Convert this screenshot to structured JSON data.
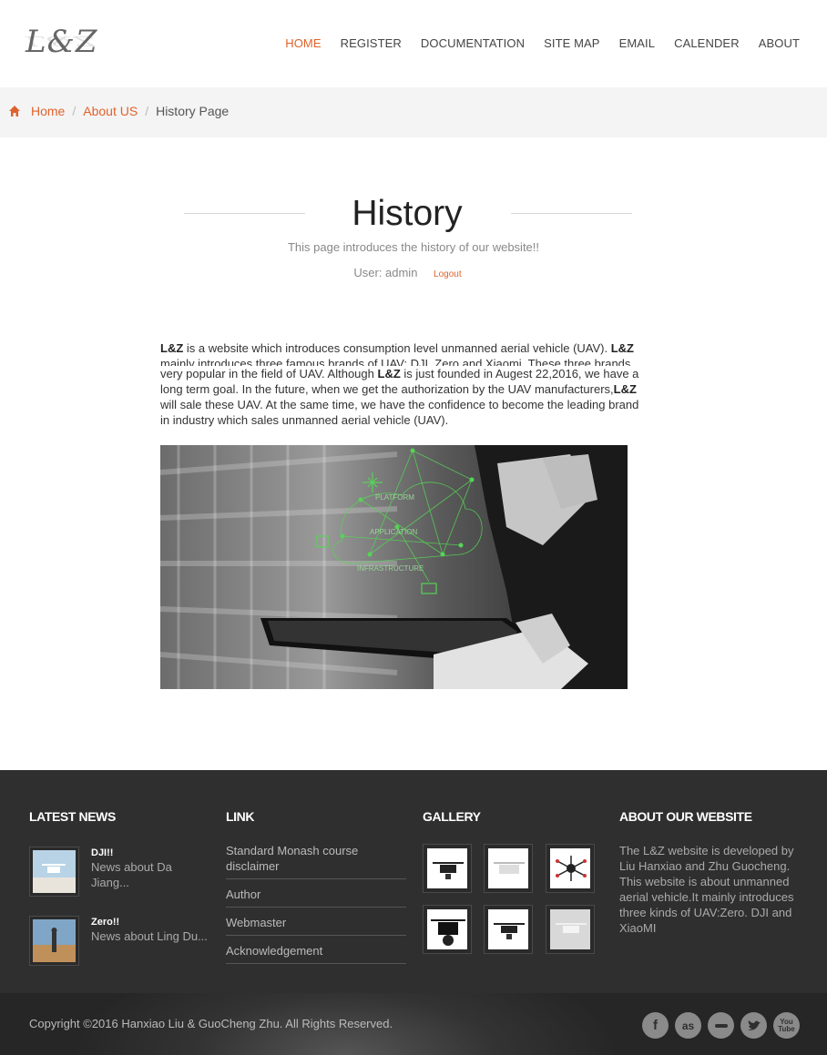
{
  "header": {
    "logo_text": "L&Z",
    "nav": [
      {
        "label": "HOME",
        "active": true
      },
      {
        "label": "REGISTER"
      },
      {
        "label": "DOCUMENTATION"
      },
      {
        "label": "SITE MAP"
      },
      {
        "label": "EMAIL"
      },
      {
        "label": "CALENDER"
      },
      {
        "label": "ABOUT"
      }
    ]
  },
  "breadcrumb": {
    "items": [
      "Home",
      "About US"
    ],
    "current": "History Page"
  },
  "page": {
    "title": "History",
    "subtitle": "This page introduces the history of our website!!",
    "user_label": "User: admin",
    "logout_label": "Logout"
  },
  "content": {
    "brand": "L&Z",
    "p1a": " is a website which introduces consumption level unmanned aerial vehicle (UAV). ",
    "p1b": "mainly introduces three famous brands of UAV: DJI, Zero and Xiaomi. These three brands are",
    "p1c": "very popular in the field of UAV. Although ",
    "p1d": " is just founded in Augest 22,2016, we have a long term goal. In the future, when we get the authorization by the UAV manufacturers,",
    "p1e": " will sale these UAV. At the same time, we have the confidence to become the leading brand in industry which sales unmanned aerial vehicle (UAV).",
    "hero_overlay_labels": [
      "PLATFORM",
      "APPLICATION",
      "INFRASTRUCTURE"
    ]
  },
  "footer": {
    "latest_news_heading": "LATEST NEWS",
    "news": [
      {
        "title": "DJI!!",
        "desc": "News about Da Jiang..."
      },
      {
        "title": "Zero!!",
        "desc": "News about Ling Du..."
      }
    ],
    "link_heading": "LINK",
    "links": [
      "Standard Monash course disclaimer",
      "Author",
      "Webmaster",
      "Acknowledgement"
    ],
    "gallery_heading": "GALLERY",
    "about_heading": "ABOUT OUR WEBSITE",
    "about_text": "The L&Z website is developed by Liu Hanxiao and Zhu Guocheng. This website is about unmanned aerial vehicle.It mainly introduces three kinds of UAV:Zero. DJI and XiaoMI",
    "copyright": "Copyright ©2016 Hanxiao Liu & GuoCheng Zhu. All Rights Reserved.",
    "social_icons": [
      "facebook-icon",
      "lastfm-icon",
      "blogger-icon",
      "twitter-icon",
      "youtube-icon"
    ]
  },
  "colors": {
    "accent": "#e0622b",
    "footer_bg": "#2f2f2f",
    "crumb_bg": "#f4f4f4"
  }
}
